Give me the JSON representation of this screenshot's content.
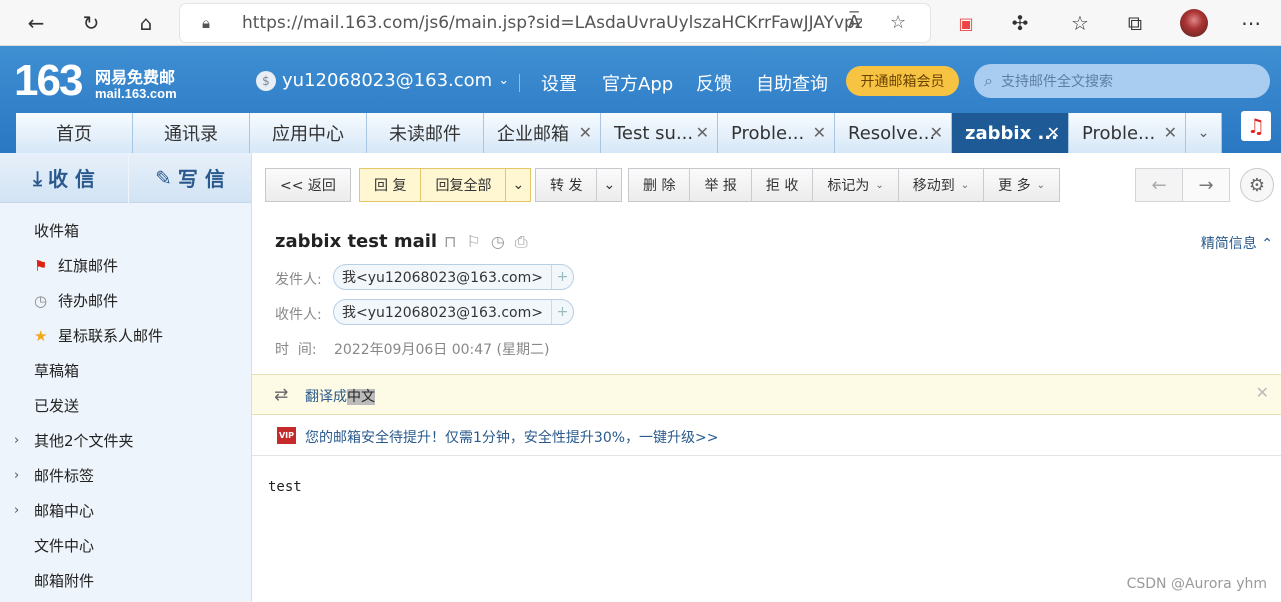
{
  "browser": {
    "url": "https://mail.163.com/js6/main.jsp?sid=LAsdaUvraUylszaHCKrrFawJJAYvpzd...",
    "read_aloud_glyph": "A̅"
  },
  "header": {
    "logo_number": "163",
    "logo_cn": "网易免费邮",
    "logo_domain": "mail.163.com",
    "account": "yu12068023@163.com",
    "links": [
      "设置",
      "官方App",
      "反馈",
      "自助查询"
    ],
    "vip_button": "开通邮箱会员",
    "search_placeholder": "支持邮件全文搜索"
  },
  "tabs": [
    {
      "label": "首页",
      "closeable": false
    },
    {
      "label": "通讯录",
      "closeable": false
    },
    {
      "label": "应用中心",
      "closeable": false
    },
    {
      "label": "未读邮件",
      "closeable": false
    },
    {
      "label": "企业邮箱",
      "closeable": true
    },
    {
      "label": "Test su...",
      "closeable": true
    },
    {
      "label": "Proble...",
      "closeable": true
    },
    {
      "label": "Resolve...",
      "closeable": true
    },
    {
      "label": "zabbix ...",
      "closeable": true,
      "active": true
    },
    {
      "label": "Proble...",
      "closeable": true
    }
  ],
  "sidebar": {
    "receive": "收 信",
    "compose": "写 信",
    "folders": [
      {
        "label": "收件箱",
        "icon": ""
      },
      {
        "label": "红旗邮件",
        "icon": "red-flag-icon"
      },
      {
        "label": "待办邮件",
        "icon": "clock-icon"
      },
      {
        "label": "星标联系人邮件",
        "icon": "star-icon"
      },
      {
        "label": "草稿箱",
        "icon": ""
      },
      {
        "label": "已发送",
        "icon": ""
      },
      {
        "label": "其他2个文件夹",
        "icon": "chevron-right-icon"
      },
      {
        "label": "邮件标签",
        "icon": "chevron-right-icon"
      },
      {
        "label": "邮箱中心",
        "icon": "chevron-right-icon"
      },
      {
        "label": "文件中心",
        "icon": ""
      },
      {
        "label": "邮箱附件",
        "icon": ""
      }
    ]
  },
  "toolbar": {
    "back": "<< 返回",
    "reply": "回 复",
    "reply_all": "回复全部",
    "forward": "转 发",
    "delete": "删 除",
    "report": "举 报",
    "reject": "拒 收",
    "mark_as": "标记为",
    "move_to": "移动到",
    "more": "更 多"
  },
  "mail": {
    "subject": "zabbix test mail",
    "precise_info": "精简信息",
    "from_label": "发件人:",
    "from": "我<yu12068023@163.com>",
    "to_label": "收件人:",
    "to": "我<yu12068023@163.com>",
    "time_label": "时  间:",
    "time": "2022年09月06日 00:47 (星期二)",
    "translate_prefix": "翻译成",
    "translate_target": "中文",
    "security_notice": "您的邮箱安全待提升！仅需1分钟，安全性提升30%，一键升级>>",
    "body": "test"
  },
  "watermark": "CSDN @Aurora yhm"
}
